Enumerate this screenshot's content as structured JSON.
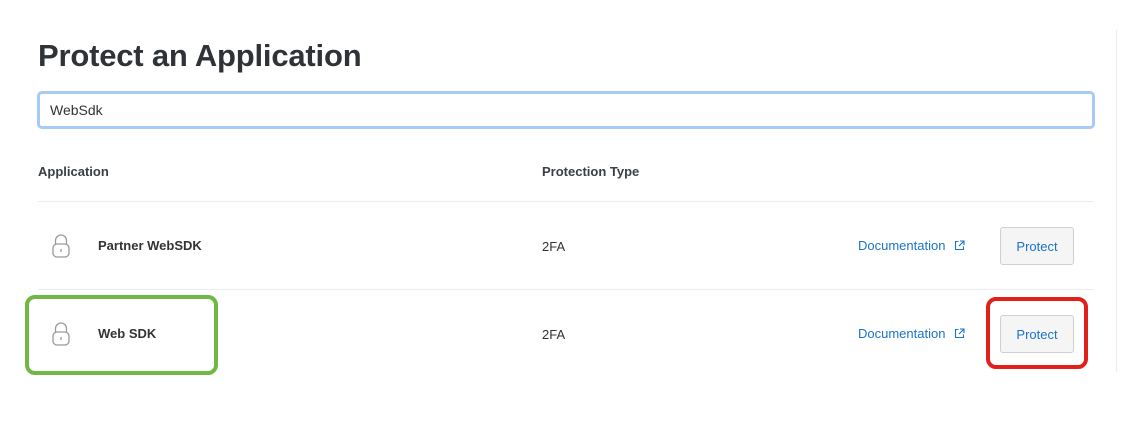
{
  "page": {
    "title": "Protect an Application"
  },
  "search": {
    "value": "WebSdk"
  },
  "table": {
    "columns": {
      "application": "Application",
      "protection_type": "Protection Type"
    },
    "rows": [
      {
        "icon": "lock-icon",
        "name": "Partner WebSDK",
        "protection_type": "2FA",
        "documentation_label": "Documentation",
        "protect_label": "Protect"
      },
      {
        "icon": "lock-icon",
        "name": "Web SDK",
        "protection_type": "2FA",
        "documentation_label": "Documentation",
        "protect_label": "Protect"
      }
    ]
  },
  "annotations": {
    "green_box_color": "#6fb843",
    "red_box_color": "#e0201a"
  },
  "colors": {
    "link": "#1a73c9",
    "search_focus": "#a6cbf6"
  }
}
